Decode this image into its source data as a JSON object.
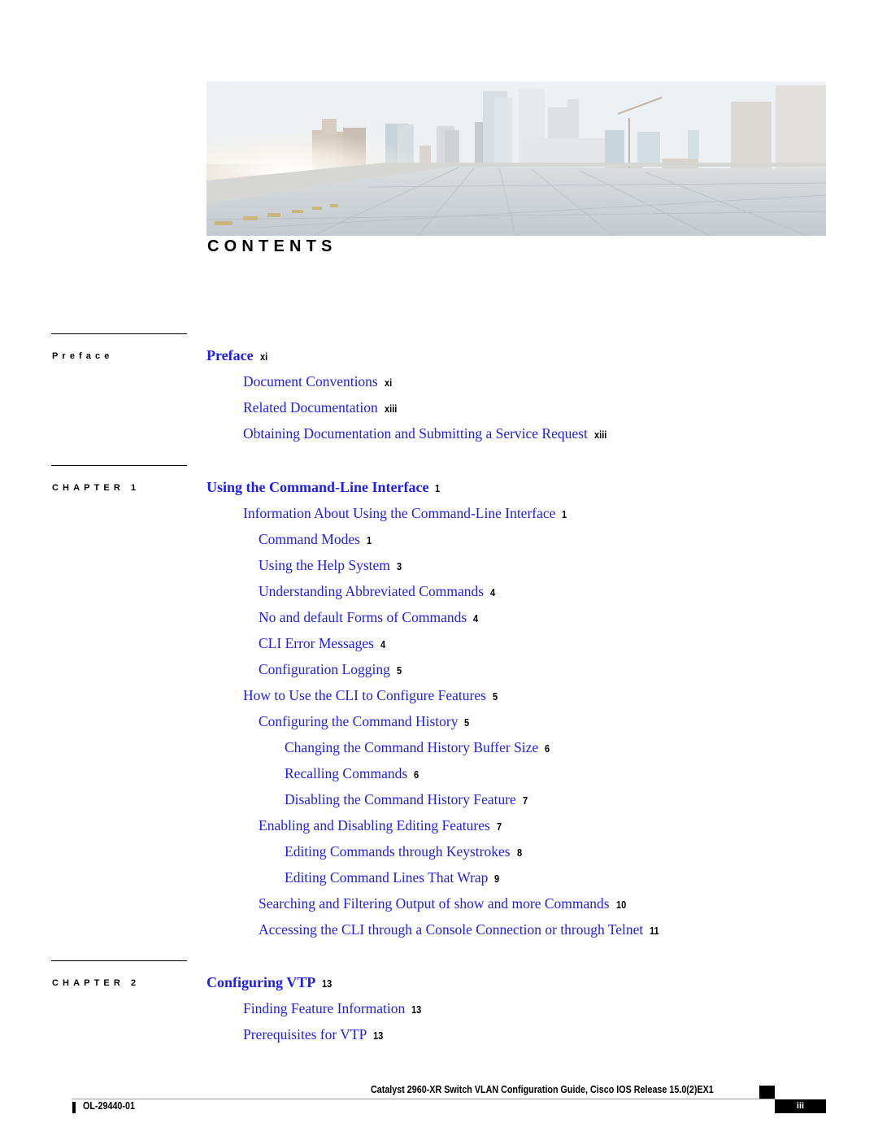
{
  "header": {
    "hero_image_alt": "City skyline viewed from a rooftop covered with solar panels",
    "title": "CONTENTS"
  },
  "sections": [
    {
      "label": "Preface",
      "entries": [
        {
          "title": "Preface",
          "page": "xi",
          "level": 0
        },
        {
          "title": "Document Conventions",
          "page": "xi",
          "level": 1
        },
        {
          "title": "Related Documentation",
          "page": "xiii",
          "level": 1
        },
        {
          "title": "Obtaining Documentation and Submitting a Service Request",
          "page": "xiii",
          "level": 1
        }
      ]
    },
    {
      "label": "CHAPTER 1",
      "entries": [
        {
          "title": "Using the Command-Line Interface",
          "page": "1",
          "level": 0
        },
        {
          "title": "Information About Using the Command-Line Interface",
          "page": "1",
          "level": 1
        },
        {
          "title": "Command Modes",
          "page": "1",
          "level": 2
        },
        {
          "title": "Using the Help System",
          "page": "3",
          "level": 2
        },
        {
          "title": "Understanding Abbreviated Commands",
          "page": "4",
          "level": 2
        },
        {
          "title": "No and default Forms of Commands",
          "page": "4",
          "level": 2
        },
        {
          "title": "CLI Error Messages",
          "page": "4",
          "level": 2
        },
        {
          "title": "Configuration Logging",
          "page": "5",
          "level": 2
        },
        {
          "title": "How to Use the CLI to Configure Features",
          "page": "5",
          "level": 1
        },
        {
          "title": "Configuring the Command History",
          "page": "5",
          "level": 2
        },
        {
          "title": "Changing the Command History Buffer Size",
          "page": "6",
          "level": 3
        },
        {
          "title": "Recalling Commands",
          "page": "6",
          "level": 3
        },
        {
          "title": "Disabling the Command History Feature",
          "page": "7",
          "level": 3
        },
        {
          "title": "Enabling and Disabling Editing Features",
          "page": "7",
          "level": 2
        },
        {
          "title": "Editing Commands through Keystrokes",
          "page": "8",
          "level": 3
        },
        {
          "title": "Editing Command Lines That Wrap",
          "page": "9",
          "level": 3
        },
        {
          "title": "Searching and Filtering Output of show and more Commands",
          "page": "10",
          "level": 2
        },
        {
          "title": "Accessing the CLI through a Console Connection or through Telnet",
          "page": "11",
          "level": 2
        }
      ]
    },
    {
      "label": "CHAPTER 2",
      "entries": [
        {
          "title": "Configuring VTP",
          "page": "13",
          "level": 0
        },
        {
          "title": "Finding Feature Information",
          "page": "13",
          "level": 1
        },
        {
          "title": "Prerequisites for VTP",
          "page": "13",
          "level": 1
        }
      ]
    }
  ],
  "footer": {
    "guide_title": "Catalyst 2960-XR Switch VLAN Configuration Guide, Cisco IOS Release 15.0(2)EX1",
    "doc_number": "OL-29440-01",
    "page_number": "iii"
  },
  "colors": {
    "link": "#1c1cf5",
    "text": "#000000"
  }
}
